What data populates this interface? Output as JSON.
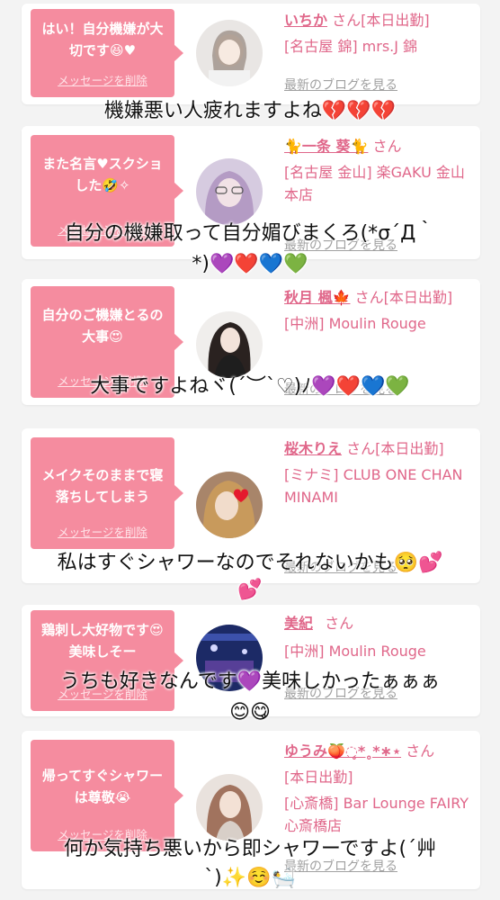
{
  "messages": [
    {
      "bubble": "はい！自分機嫌が大切です😆♥",
      "delete": "メッセージを削除",
      "name": "いちか",
      "san": "さん",
      "status": "[本日出勤]",
      "shop": "[名古屋 錦] mrs.J 錦",
      "blog": "最新のブログを見る",
      "avatar_color": "#d8d4d2"
    },
    {
      "bubble": "また名言♥スクショした🤣✧",
      "delete": "メッセージを削除",
      "name": "🐈一条 葵🐈",
      "san": "さん",
      "shop": "[名古屋 金山] 楽GAKU 金山本店",
      "blog": "最新のブログを見る",
      "avatar_color": "#b7a8c8"
    },
    {
      "bubble": "自分のご機嫌とるの大事😍",
      "delete": "メッセージを削除",
      "name": "秋月 楓🍁",
      "san": "さん",
      "status": "[本日出勤]",
      "shop": "[中洲] Moulin Rouge",
      "blog": "最新のブログを見る",
      "avatar_color": "#3a3a3a"
    },
    {
      "bubble": "メイクそのままで寝落ちしてしまう",
      "delete": "メッセージを削除",
      "name": "桜木りえ",
      "san": "さん",
      "status": "[本日出勤]",
      "shop": "[ミナミ] CLUB ONE CHAN MINAMI",
      "blog": "最新のブログを見る",
      "avatar_color": "#c89a6a"
    },
    {
      "bubble": "鶏刺し大好物です😍美味しそー",
      "delete": "メッセージを削除",
      "name": "美紀",
      "san": "さん",
      "shop": "[中洲] Moulin Rouge",
      "blog": "最新のブログを見る",
      "avatar_color": "#2a3a7a"
    },
    {
      "bubble": "帰ってすぐシャワーは尊敬😭",
      "delete": "メッセージを削除",
      "name": "ゆうみ🍑◌̥*˳*∗⋆",
      "san": "さん",
      "status": "[本日出勤]",
      "shop": "[心斎橋] Bar Lounge FAIRY 心斎橋店",
      "blog": "最新のブログを見る",
      "avatar_color": "#b78a73"
    }
  ],
  "overlays": [
    "機嫌悪い人疲れますよね💔💔💔",
    "自分の機嫌取って自分媚びまくろ(*σ´Д｀",
    "*)💜❤️💙💚",
    "大事ですよねヾ(´︶`♡)ﾉ💜❤️💙💚",
    "私はすぐシャワーなのでそれないかも🥺💕",
    "💕",
    "うちも好きなんです💜美味しかったぁぁぁ",
    "😊😋",
    "何か気持ち悪いから即シャワーですよ(´艸",
    "`)✨☺️🛀"
  ]
}
